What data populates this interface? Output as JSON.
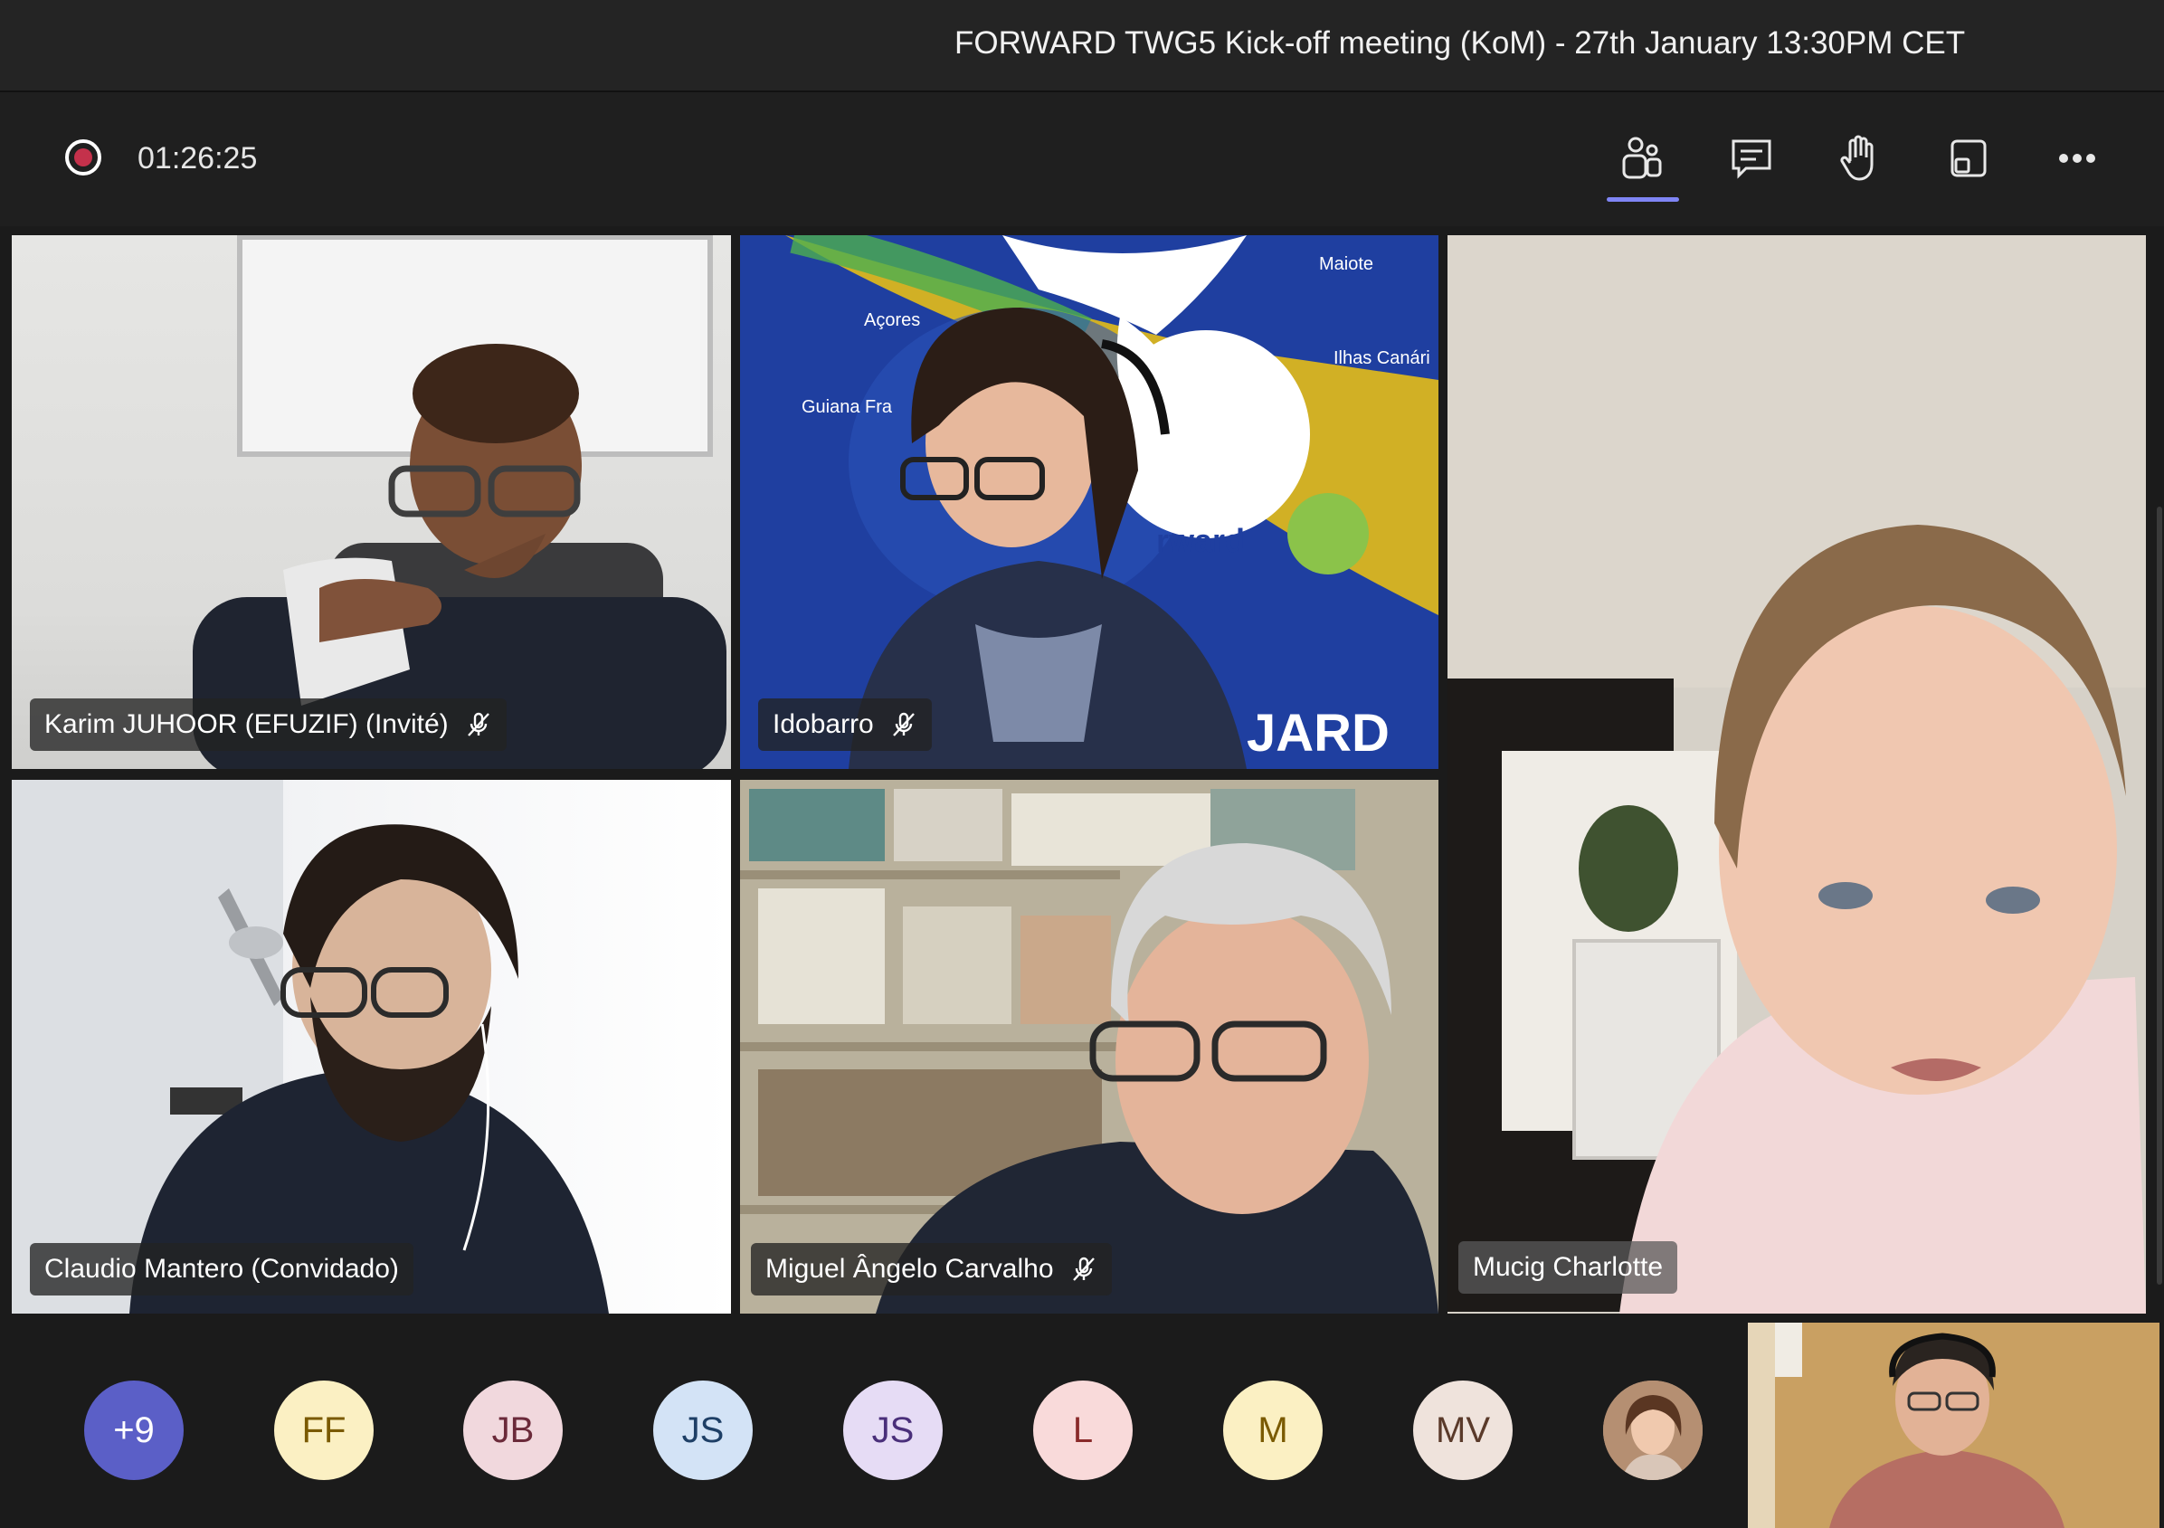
{
  "meeting": {
    "title": "FORWARD TWG5 Kick-off meeting (KoM) - 27th January 13:30PM CET"
  },
  "toolbar": {
    "timer": "01:26:25",
    "buttons": [
      {
        "icon": "people-icon",
        "active": true
      },
      {
        "icon": "chat-icon"
      },
      {
        "icon": "raise-hand-icon"
      },
      {
        "icon": "share-tray-icon"
      },
      {
        "icon": "more-options-icon"
      }
    ]
  },
  "participants": [
    {
      "name": "Karim JUHOOR (EFUZIF) (Invité)",
      "muted": true
    },
    {
      "name": "Idobarro",
      "muted": true
    },
    {
      "name": "Mucig Charlotte",
      "muted": false
    },
    {
      "name": "Claudio Mantero (Convidado)",
      "muted": false
    },
    {
      "name": "Miguel Ângelo Carvalho",
      "muted": true
    }
  ],
  "background_map": {
    "labels": [
      "Maiote",
      "Açores",
      "Ilhas Canári",
      "Guiana Fra",
      "rward",
      "JARD"
    ]
  },
  "roster": [
    {
      "initials": "+9",
      "bg": "#5b5fc7",
      "fg": "#ffffff"
    },
    {
      "initials": "FF",
      "bg": "#fbf0c3",
      "fg": "#7a5a00"
    },
    {
      "initials": "JB",
      "bg": "#f1d8dd",
      "fg": "#6b2a3a"
    },
    {
      "initials": "JS",
      "bg": "#d3e3f6",
      "fg": "#1e3f66"
    },
    {
      "initials": "JS",
      "bg": "#e6dcf5",
      "fg": "#4a2f7a"
    },
    {
      "initials": "L",
      "bg": "#f9dada",
      "fg": "#8a2a2a"
    },
    {
      "initials": "M",
      "bg": "#fbf0c3",
      "fg": "#7a5a00"
    },
    {
      "initials": "MV",
      "bg": "#efe3dc",
      "fg": "#5a3a2a"
    }
  ],
  "colors": {
    "recording": "#c4314b",
    "accent": "#7f85f5"
  }
}
